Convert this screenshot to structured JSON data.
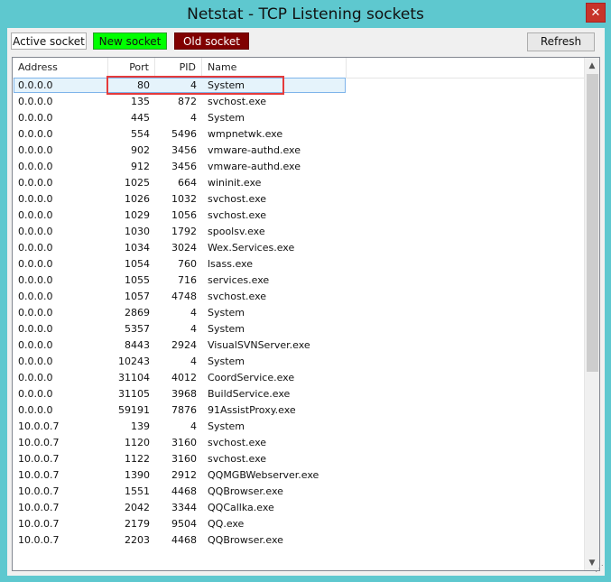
{
  "window": {
    "title": "Netstat - TCP Listening sockets",
    "close_label": "✕"
  },
  "toolbar": {
    "active_label": "Active socket",
    "new_label": "New socket",
    "old_label": "Old socket",
    "refresh_label": "Refresh"
  },
  "colors": {
    "new_socket": "#00ff00",
    "old_socket": "#800000",
    "highlight_box": "#e53b3b"
  },
  "table": {
    "columns": [
      "Address",
      "Port",
      "PID",
      "Name"
    ],
    "rows": [
      {
        "address": "0.0.0.0",
        "port": "80",
        "pid": "4",
        "name": "System"
      },
      {
        "address": "0.0.0.0",
        "port": "135",
        "pid": "872",
        "name": "svchost.exe"
      },
      {
        "address": "0.0.0.0",
        "port": "445",
        "pid": "4",
        "name": "System"
      },
      {
        "address": "0.0.0.0",
        "port": "554",
        "pid": "5496",
        "name": "wmpnetwk.exe"
      },
      {
        "address": "0.0.0.0",
        "port": "902",
        "pid": "3456",
        "name": "vmware-authd.exe"
      },
      {
        "address": "0.0.0.0",
        "port": "912",
        "pid": "3456",
        "name": "vmware-authd.exe"
      },
      {
        "address": "0.0.0.0",
        "port": "1025",
        "pid": "664",
        "name": "wininit.exe"
      },
      {
        "address": "0.0.0.0",
        "port": "1026",
        "pid": "1032",
        "name": "svchost.exe"
      },
      {
        "address": "0.0.0.0",
        "port": "1029",
        "pid": "1056",
        "name": "svchost.exe"
      },
      {
        "address": "0.0.0.0",
        "port": "1030",
        "pid": "1792",
        "name": "spoolsv.exe"
      },
      {
        "address": "0.0.0.0",
        "port": "1034",
        "pid": "3024",
        "name": "Wex.Services.exe"
      },
      {
        "address": "0.0.0.0",
        "port": "1054",
        "pid": "760",
        "name": "lsass.exe"
      },
      {
        "address": "0.0.0.0",
        "port": "1055",
        "pid": "716",
        "name": "services.exe"
      },
      {
        "address": "0.0.0.0",
        "port": "1057",
        "pid": "4748",
        "name": "svchost.exe"
      },
      {
        "address": "0.0.0.0",
        "port": "2869",
        "pid": "4",
        "name": "System"
      },
      {
        "address": "0.0.0.0",
        "port": "5357",
        "pid": "4",
        "name": "System"
      },
      {
        "address": "0.0.0.0",
        "port": "8443",
        "pid": "2924",
        "name": "VisualSVNServer.exe"
      },
      {
        "address": "0.0.0.0",
        "port": "10243",
        "pid": "4",
        "name": "System"
      },
      {
        "address": "0.0.0.0",
        "port": "31104",
        "pid": "4012",
        "name": "CoordService.exe"
      },
      {
        "address": "0.0.0.0",
        "port": "31105",
        "pid": "3968",
        "name": "BuildService.exe"
      },
      {
        "address": "0.0.0.0",
        "port": "59191",
        "pid": "7876",
        "name": "91AssistProxy.exe"
      },
      {
        "address": "10.0.0.7",
        "port": "139",
        "pid": "4",
        "name": "System"
      },
      {
        "address": "10.0.0.7",
        "port": "1120",
        "pid": "3160",
        "name": "svchost.exe"
      },
      {
        "address": "10.0.0.7",
        "port": "1122",
        "pid": "3160",
        "name": "svchost.exe"
      },
      {
        "address": "10.0.0.7",
        "port": "1390",
        "pid": "2912",
        "name": "QQMGBWebserver.exe"
      },
      {
        "address": "10.0.0.7",
        "port": "1551",
        "pid": "4468",
        "name": "QQBrowser.exe"
      },
      {
        "address": "10.0.0.7",
        "port": "2042",
        "pid": "3344",
        "name": "QQCallka.exe"
      },
      {
        "address": "10.0.0.7",
        "port": "2179",
        "pid": "9504",
        "name": "QQ.exe"
      },
      {
        "address": "10.0.0.7",
        "port": "2203",
        "pid": "4468",
        "name": "QQBrowser.exe"
      }
    ]
  },
  "scrollbar": {
    "up_icon": "▲",
    "down_icon": "▼"
  }
}
